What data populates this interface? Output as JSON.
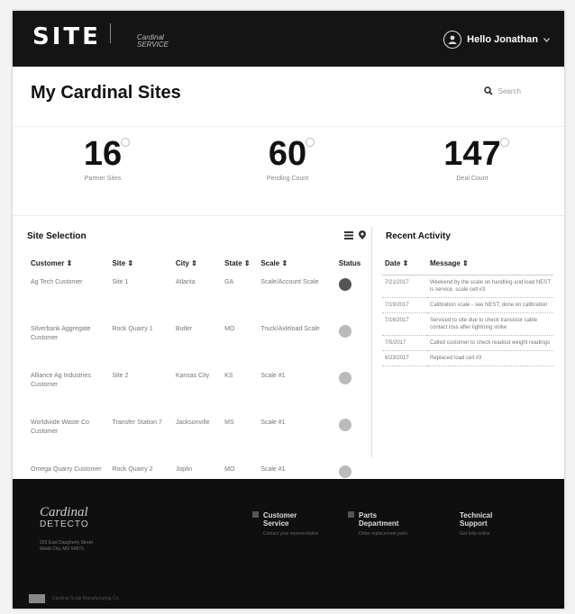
{
  "header": {
    "logo": "SITE",
    "brand_small_line1": "Cardinal",
    "brand_small_line2": "SERVICE",
    "user_greeting": "Hello Jonathan"
  },
  "page": {
    "title": "My Cardinal Sites",
    "search_placeholder": "Search"
  },
  "stats": [
    {
      "value": "16",
      "label": "Partner Sites"
    },
    {
      "value": "60",
      "label": "Pending Count"
    },
    {
      "value": "147",
      "label": "Deal Count"
    }
  ],
  "site_selection": {
    "title": "Site Selection",
    "columns": [
      "Customer ⇕",
      "Site ⇕",
      "City ⇕",
      "State ⇕",
      "Scale ⇕",
      "Status"
    ],
    "rows": [
      {
        "customer": "Ag Tech Customer",
        "site": "Site 1",
        "city": "Atlanta",
        "state": "GA",
        "scale": "Scale/Account Scale",
        "status": "dark"
      },
      {
        "customer": "Silverbank Aggregate Customer",
        "site": "Rock Quarry 1",
        "city": "Butler",
        "state": "MO",
        "scale": "Truck/Axleload Scale",
        "status": "light"
      },
      {
        "customer": "Alliance Ag Industries Customer",
        "site": "Site 2",
        "city": "Kansas City",
        "state": "KS",
        "scale": "Scale #1",
        "status": "light"
      },
      {
        "customer": "Worldwide Waste Co Customer",
        "site": "Transfer Station 7",
        "city": "Jacksonville",
        "state": "MS",
        "scale": "Scale #1",
        "status": "light"
      },
      {
        "customer": "Omega Quarry Customer",
        "site": "Rock Quarry 2",
        "city": "Joplin",
        "state": "MO",
        "scale": "Scale #1",
        "status": "light"
      }
    ]
  },
  "activity": {
    "title": "Recent Activity",
    "columns": [
      "Date ⇕",
      "Message ⇕"
    ],
    "rows": [
      {
        "date": "7/21/2017",
        "message": "Weekend by the scale on handling and load NEST is service. scale cell #3"
      },
      {
        "date": "7/19/2017",
        "message": "Calibration scale - see NEST; done on calibration"
      },
      {
        "date": "7/16/2017",
        "message": "Serviced to site due to check transistor cable contact loss after lightning strike"
      },
      {
        "date": "7/5/2017",
        "message": "Called customer to check readout weight readings"
      },
      {
        "date": "6/23/2017",
        "message": "Replaced load cell #3"
      }
    ]
  },
  "footer": {
    "brand_line1": "Cardinal",
    "brand_line2": "DETECTO",
    "address_line1": "203 East Daugherty Street",
    "address_line2": "Webb City, MO 64870",
    "columns": [
      {
        "title_line1": "Customer",
        "title_line2": "Service",
        "sub": "Contact your representative"
      },
      {
        "title_line1": "Parts",
        "title_line2": "Department",
        "sub": "Order replacement parts"
      },
      {
        "title_line1": "Technical",
        "title_line2": "Support",
        "sub": "Get help online"
      }
    ],
    "bottom_text": "Cardinal Scale Manufacturing Co."
  }
}
